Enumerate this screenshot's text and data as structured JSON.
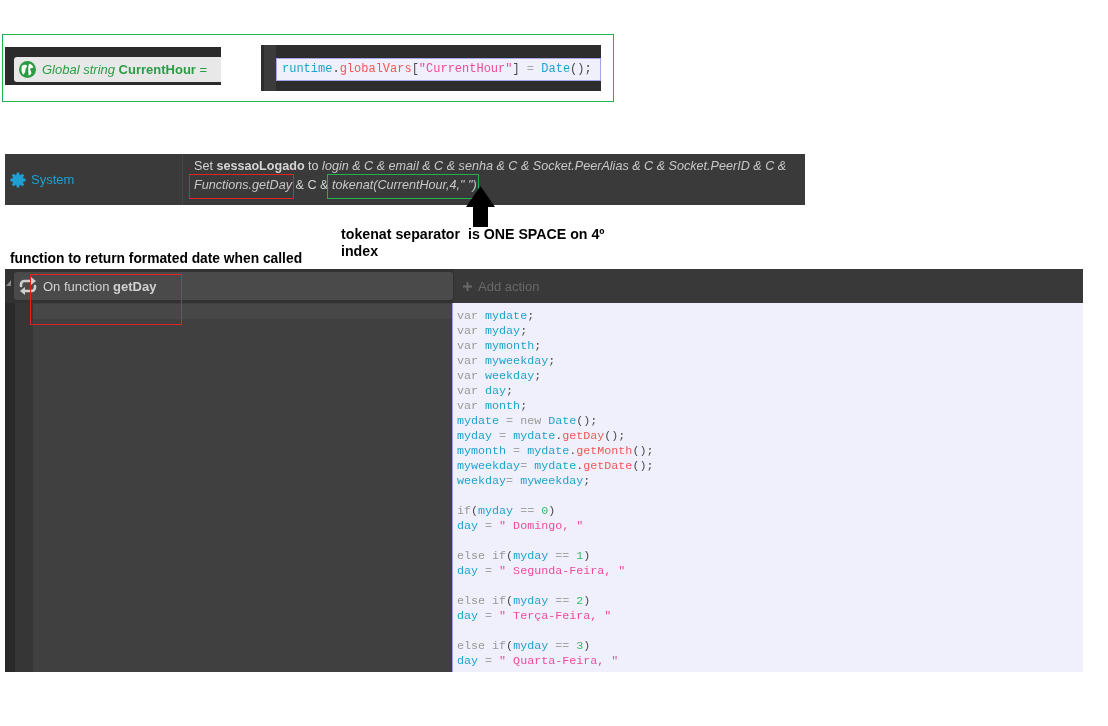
{
  "global_variable": {
    "declaration": "*Global string* **CurrentHour** =",
    "script_line": [
      {
        "kind": "ident",
        "text": "runtime"
      },
      {
        "kind": "punct",
        "text": "."
      },
      {
        "kind": "method",
        "text": "globalVars"
      },
      {
        "kind": "punct",
        "text": "["
      },
      {
        "kind": "string",
        "text": "\"CurrentHour\""
      },
      {
        "kind": "punct",
        "text": "]"
      },
      {
        "kind": "op",
        "text": " = "
      },
      {
        "kind": "ident",
        "text": "Date"
      },
      {
        "kind": "punct",
        "text": "();"
      }
    ]
  },
  "system_event": {
    "object": "System",
    "action_parts": [
      {
        "text": "Set **sessaoLogado** to *login & C & email & C & senha & C & Socket.PeerAlias & C & Socket.PeerID & C &* "
      },
      {
        "text": "*Functions.getDay*",
        "color": "#e02424"
      },
      {
        "text": " & C & "
      },
      {
        "text": "*tokenat(CurrentHour,4,\" \")*",
        "color": "#22b14c"
      }
    ]
  },
  "annotations": {
    "separator_note": "tokenat separator  is ONE SPACE on 4º index",
    "function_note": "function to return formated date when called"
  },
  "function_event": {
    "condition": "On function **getDay**",
    "add_action": "Add action",
    "script_blocks": [
      [
        [
          {
            "kind": "keyword",
            "text": "var "
          },
          {
            "kind": "ident",
            "text": "mydate"
          },
          {
            "kind": "punct",
            "text": ";"
          }
        ],
        [
          {
            "kind": "keyword",
            "text": "var "
          },
          {
            "kind": "ident",
            "text": "myday"
          },
          {
            "kind": "punct",
            "text": ";"
          }
        ],
        [
          {
            "kind": "keyword",
            "text": "var "
          },
          {
            "kind": "ident",
            "text": "mymonth"
          },
          {
            "kind": "punct",
            "text": ";"
          }
        ],
        [
          {
            "kind": "keyword",
            "text": "var "
          },
          {
            "kind": "ident",
            "text": "myweekday"
          },
          {
            "kind": "punct",
            "text": ";"
          }
        ],
        [
          {
            "kind": "keyword",
            "text": "var "
          },
          {
            "kind": "ident",
            "text": "weekday"
          },
          {
            "kind": "punct",
            "text": ";"
          }
        ],
        [
          {
            "kind": "keyword",
            "text": "var "
          },
          {
            "kind": "ident",
            "text": "day"
          },
          {
            "kind": "punct",
            "text": ";"
          }
        ],
        [
          {
            "kind": "keyword",
            "text": "var "
          },
          {
            "kind": "ident",
            "text": "month"
          },
          {
            "kind": "punct",
            "text": ";"
          }
        ],
        [
          {
            "kind": "ident",
            "text": "mydate"
          },
          {
            "kind": "op",
            "text": " = "
          },
          {
            "kind": "keyword",
            "text": "new "
          },
          {
            "kind": "ident",
            "text": "Date"
          },
          {
            "kind": "punct",
            "text": "();"
          }
        ],
        [
          {
            "kind": "ident",
            "text": "myday"
          },
          {
            "kind": "op",
            "text": " = "
          },
          {
            "kind": "ident",
            "text": "mydate"
          },
          {
            "kind": "punct",
            "text": "."
          },
          {
            "kind": "method",
            "text": "getDay"
          },
          {
            "kind": "punct",
            "text": "();"
          }
        ],
        [
          {
            "kind": "ident",
            "text": "mymonth"
          },
          {
            "kind": "op",
            "text": " = "
          },
          {
            "kind": "ident",
            "text": "mydate"
          },
          {
            "kind": "punct",
            "text": "."
          },
          {
            "kind": "method",
            "text": "getMonth"
          },
          {
            "kind": "punct",
            "text": "();"
          }
        ],
        [
          {
            "kind": "ident",
            "text": "myweekday"
          },
          {
            "kind": "op",
            "text": "= "
          },
          {
            "kind": "ident",
            "text": "mydate"
          },
          {
            "kind": "punct",
            "text": "."
          },
          {
            "kind": "method",
            "text": "getDate"
          },
          {
            "kind": "punct",
            "text": "();"
          }
        ],
        [
          {
            "kind": "ident",
            "text": "weekday"
          },
          {
            "kind": "op",
            "text": "= "
          },
          {
            "kind": "ident",
            "text": "myweekday"
          },
          {
            "kind": "punct",
            "text": ";"
          }
        ]
      ],
      [
        [
          {
            "kind": "keyword",
            "text": "if"
          },
          {
            "kind": "punct",
            "text": "("
          },
          {
            "kind": "ident",
            "text": "myday"
          },
          {
            "kind": "op",
            "text": " == "
          },
          {
            "kind": "number",
            "text": "0"
          },
          {
            "kind": "punct",
            "text": ")"
          }
        ],
        [
          {
            "kind": "ident",
            "text": "day"
          },
          {
            "kind": "op",
            "text": " = "
          },
          {
            "kind": "string",
            "text": "\" Domingo, \""
          }
        ]
      ],
      [
        [
          {
            "kind": "keyword",
            "text": "else if"
          },
          {
            "kind": "punct",
            "text": "("
          },
          {
            "kind": "ident",
            "text": "myday"
          },
          {
            "kind": "op",
            "text": " == "
          },
          {
            "kind": "number",
            "text": "1"
          },
          {
            "kind": "punct",
            "text": ")"
          }
        ],
        [
          {
            "kind": "ident",
            "text": "day"
          },
          {
            "kind": "op",
            "text": " = "
          },
          {
            "kind": "string",
            "text": "\" Segunda-Feira, \""
          }
        ]
      ],
      [
        [
          {
            "kind": "keyword",
            "text": "else if"
          },
          {
            "kind": "punct",
            "text": "("
          },
          {
            "kind": "ident",
            "text": "myday"
          },
          {
            "kind": "op",
            "text": " == "
          },
          {
            "kind": "number",
            "text": "2"
          },
          {
            "kind": "punct",
            "text": ")"
          }
        ],
        [
          {
            "kind": "ident",
            "text": "day"
          },
          {
            "kind": "op",
            "text": " = "
          },
          {
            "kind": "string",
            "text": "\" Terça-Feira, \""
          }
        ]
      ],
      [
        [
          {
            "kind": "keyword",
            "text": "else if"
          },
          {
            "kind": "punct",
            "text": "("
          },
          {
            "kind": "ident",
            "text": "myday"
          },
          {
            "kind": "op",
            "text": " == "
          },
          {
            "kind": "number",
            "text": "3"
          },
          {
            "kind": "punct",
            "text": ")"
          }
        ],
        [
          {
            "kind": "ident",
            "text": "day"
          },
          {
            "kind": "op",
            "text": " = "
          },
          {
            "kind": "string",
            "text": "\" Quarta-Feira, \""
          }
        ]
      ]
    ]
  }
}
